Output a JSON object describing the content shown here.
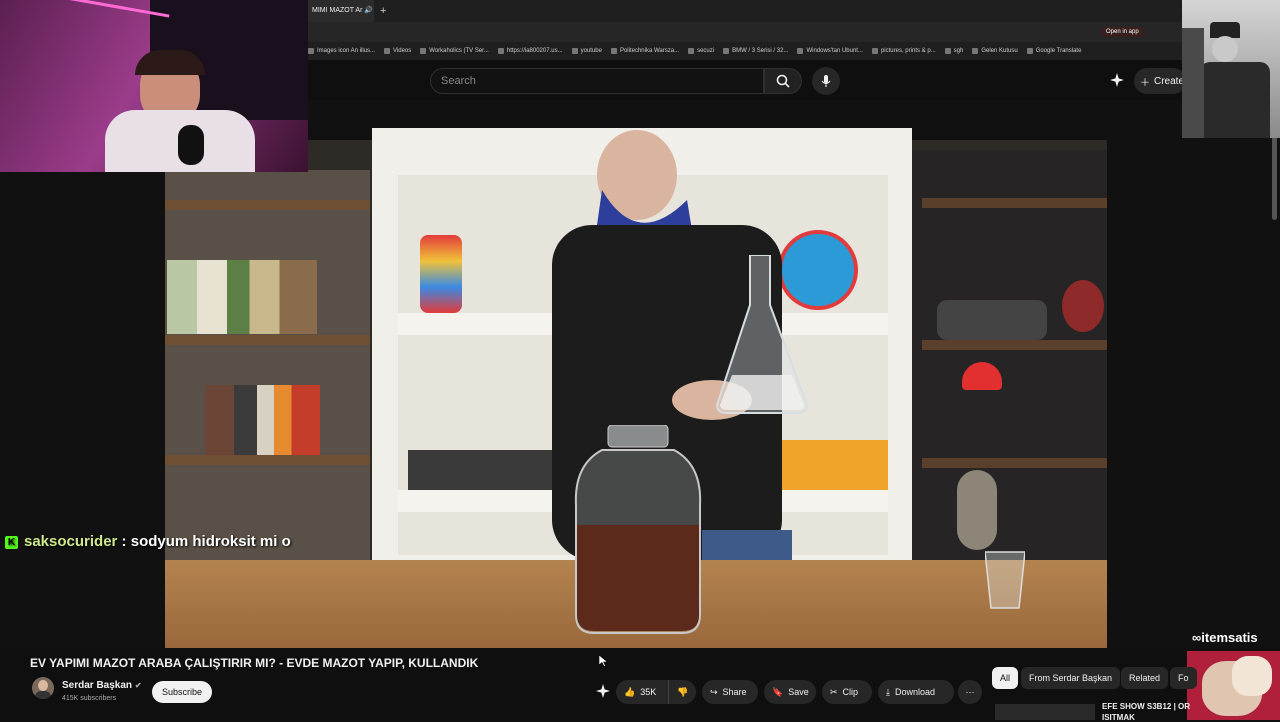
{
  "browser": {
    "active_tab_title": "MIMI MAZOT Ar",
    "open_in_app": "Open in app",
    "bookmarks": [
      "Images icon An illus...",
      "Videos",
      "Workaholics (TV Ser...",
      "https://ia800207.us...",
      "youtube",
      "Politechnika Warsza...",
      "secuzi",
      "BMW / 3 Serisi / 32...",
      "Windows'tan Ubunt...",
      "pictures, prints & p...",
      "sgh",
      "Gelen Kutusu",
      "Google Translate"
    ]
  },
  "header": {
    "search_placeholder": "Search",
    "create_label": "Create"
  },
  "overlay": {
    "chat_badge": "K",
    "chat_user": "saksocurider",
    "chat_message": " : sodyum hidroksit mi o",
    "watermark": "itemsatis"
  },
  "video": {
    "title": "EV YAPIMI MAZOT ARABA ÇALIŞTIRIR MI? - EVDE MAZOT YAPIP, KULLANDIK",
    "channel": "Serdar Başkan",
    "subscribers": "415K subscribers",
    "subscribe_label": "Subscribe",
    "likes": "35K",
    "share_label": "Share",
    "save_label": "Save",
    "clip_label": "Clip",
    "download_label": "Download"
  },
  "chips": [
    "All",
    "From Serdar Başkan",
    "Related",
    "Fo"
  ],
  "recommendation": {
    "title": "EFE SHOW S3B12 | OR",
    "subtitle": "ISITMAK"
  },
  "colors": {
    "background": "#0f0f0f",
    "kick_green": "#53fc18",
    "chip_active": "#f1f1f1"
  }
}
